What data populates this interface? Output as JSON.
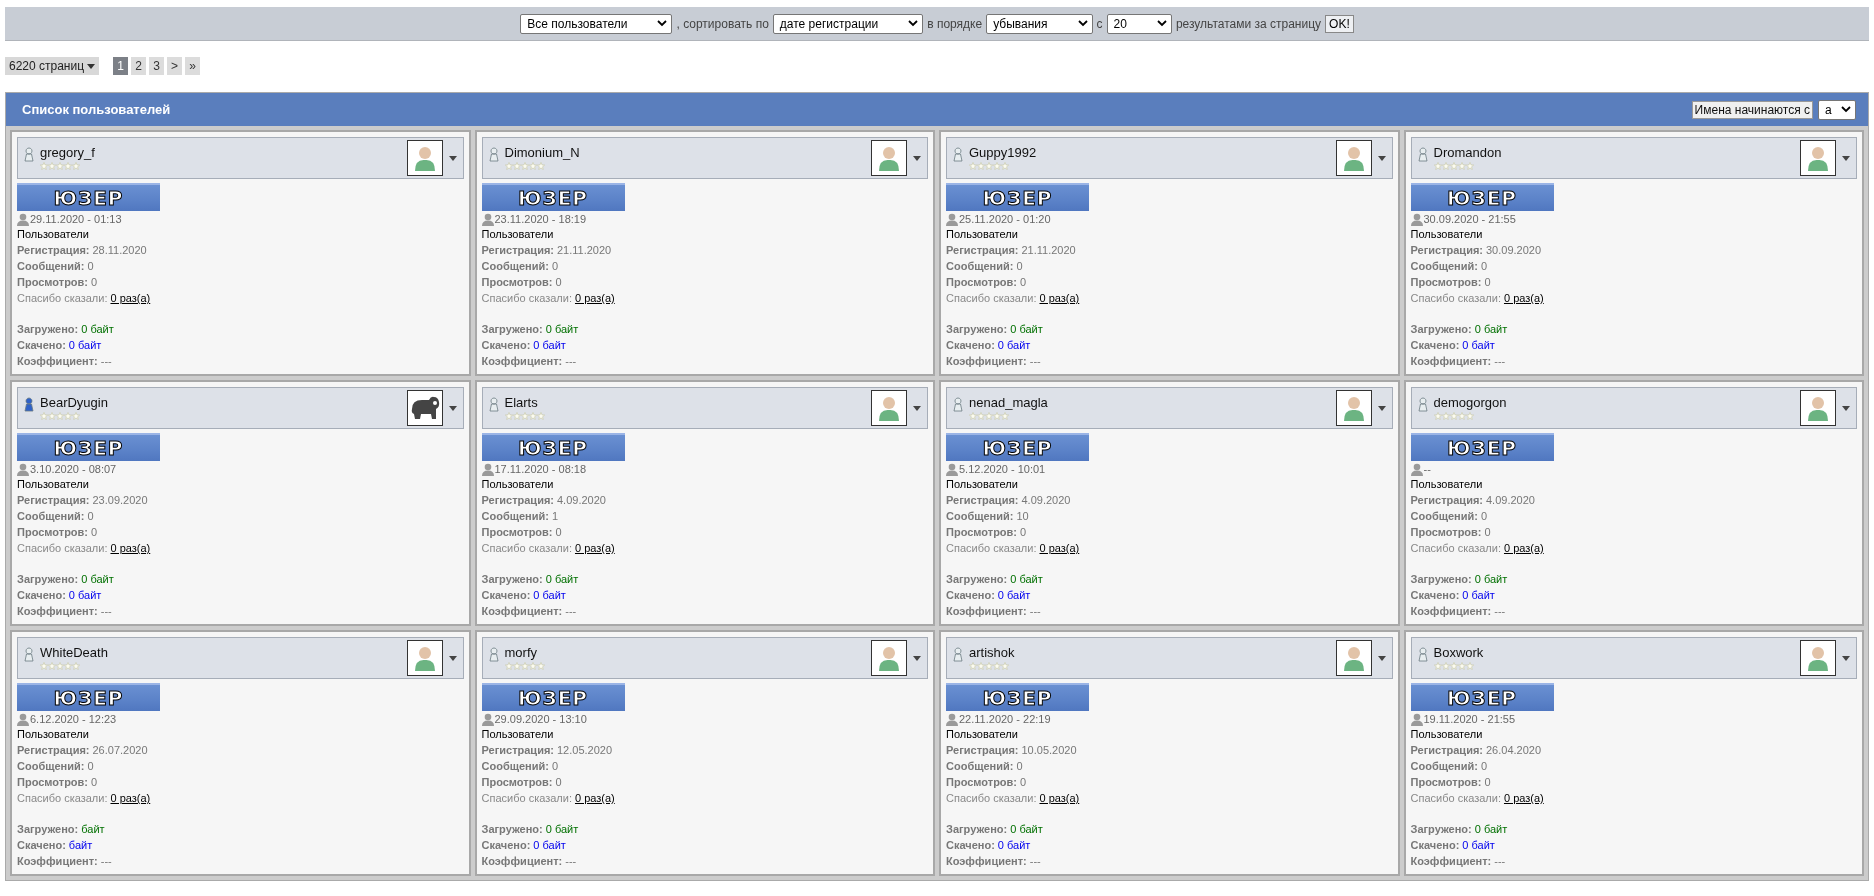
{
  "filter_bar": {
    "items": [
      {
        "kind": "select",
        "value": "Все пользователи"
      },
      {
        "kind": "text",
        "value": ", сортировать по"
      },
      {
        "kind": "select",
        "value": "дате регистрации"
      },
      {
        "kind": "text",
        "value": "в порядке"
      },
      {
        "kind": "select",
        "value": "убывания"
      },
      {
        "kind": "text",
        "value": "с"
      },
      {
        "kind": "select",
        "value": "20"
      },
      {
        "kind": "text",
        "value": "результатами за страницу"
      },
      {
        "kind": "button",
        "value": "OK!"
      }
    ]
  },
  "pagination": {
    "pages_dropdown": "6220 страниц",
    "pages": [
      {
        "label": "1",
        "selected": true
      },
      {
        "label": "2",
        "selected": false
      },
      {
        "label": "3",
        "selected": false
      },
      {
        "label": ">",
        "selected": false
      },
      {
        "label": "»",
        "selected": false
      }
    ]
  },
  "panel": {
    "title": "Список пользователей",
    "filter_label": "Имена начинаются с",
    "filter_value": "a"
  },
  "users": [
    {
      "name": "gregory_f",
      "online": false,
      "stars": 0,
      "avatar": {
        "kind": "default"
      },
      "rank": "ЮЗЕР",
      "last_visit": "29.11.2020 - 01:13",
      "group": "Пользователи",
      "stats": [
        {
          "kind": "plain",
          "label": "Регистрация:",
          "value": "28.11.2020"
        },
        {
          "kind": "plain",
          "label": "Сообщений:",
          "value": "0"
        },
        {
          "kind": "plain",
          "label": "Просмотров:",
          "value": "0"
        },
        {
          "kind": "thanks",
          "label": "Спасибо сказали:",
          "value": "0 раз(а)"
        },
        {
          "kind": "up",
          "label": "Загружено:",
          "value": "0 байт"
        },
        {
          "kind": "down",
          "label": "Скачено:",
          "value": "0 байт"
        },
        {
          "kind": "plain",
          "label": "Коэффициент:",
          "value": "---"
        }
      ]
    },
    {
      "name": "Dimonium_N",
      "online": false,
      "stars": 0,
      "avatar": {
        "kind": "default"
      },
      "rank": "ЮЗЕР",
      "last_visit": "23.11.2020 - 18:19",
      "group": "Пользователи",
      "stats": [
        {
          "kind": "plain",
          "label": "Регистрация:",
          "value": "21.11.2020"
        },
        {
          "kind": "plain",
          "label": "Сообщений:",
          "value": "0"
        },
        {
          "kind": "plain",
          "label": "Просмотров:",
          "value": "0"
        },
        {
          "kind": "thanks",
          "label": "Спасибо сказали:",
          "value": "0 раз(а)"
        },
        {
          "kind": "up",
          "label": "Загружено:",
          "value": "0 байт"
        },
        {
          "kind": "down",
          "label": "Скачено:",
          "value": "0 байт"
        },
        {
          "kind": "plain",
          "label": "Коэффициент:",
          "value": "---"
        }
      ]
    },
    {
      "name": "Guppy1992",
      "online": false,
      "stars": 0,
      "avatar": {
        "kind": "default"
      },
      "rank": "ЮЗЕР",
      "last_visit": "25.11.2020 - 01:20",
      "group": "Пользователи",
      "stats": [
        {
          "kind": "plain",
          "label": "Регистрация:",
          "value": "21.11.2020"
        },
        {
          "kind": "plain",
          "label": "Сообщений:",
          "value": "0"
        },
        {
          "kind": "plain",
          "label": "Просмотров:",
          "value": "0"
        },
        {
          "kind": "thanks",
          "label": "Спасибо сказали:",
          "value": "0 раз(а)"
        },
        {
          "kind": "up",
          "label": "Загружено:",
          "value": "0 байт"
        },
        {
          "kind": "down",
          "label": "Скачено:",
          "value": "0 байт"
        },
        {
          "kind": "plain",
          "label": "Коэффициент:",
          "value": "---"
        }
      ]
    },
    {
      "name": "Dromandon",
      "online": false,
      "stars": 0,
      "avatar": {
        "kind": "default"
      },
      "rank": "ЮЗЕР",
      "last_visit": "30.09.2020 - 21:55",
      "group": "Пользователи",
      "stats": [
        {
          "kind": "plain",
          "label": "Регистрация:",
          "value": "30.09.2020"
        },
        {
          "kind": "plain",
          "label": "Сообщений:",
          "value": "0"
        },
        {
          "kind": "plain",
          "label": "Просмотров:",
          "value": "0"
        },
        {
          "kind": "thanks",
          "label": "Спасибо сказали:",
          "value": "0 раз(а)"
        },
        {
          "kind": "up",
          "label": "Загружено:",
          "value": "0 байт"
        },
        {
          "kind": "down",
          "label": "Скачено:",
          "value": "0 байт"
        },
        {
          "kind": "plain",
          "label": "Коэффициент:",
          "value": "---"
        }
      ]
    },
    {
      "name": "BearDyugin",
      "online": true,
      "stars": 0,
      "avatar": {
        "kind": "bear"
      },
      "rank": "ЮЗЕР",
      "last_visit": "3.10.2020 - 08:07",
      "group": "Пользователи",
      "stats": [
        {
          "kind": "plain",
          "label": "Регистрация:",
          "value": "23.09.2020"
        },
        {
          "kind": "plain",
          "label": "Сообщений:",
          "value": "0"
        },
        {
          "kind": "plain",
          "label": "Просмотров:",
          "value": "0"
        },
        {
          "kind": "thanks",
          "label": "Спасибо сказали:",
          "value": "0 раз(а)"
        },
        {
          "kind": "up",
          "label": "Загружено:",
          "value": "0 байт"
        },
        {
          "kind": "down",
          "label": "Скачено:",
          "value": "0 байт"
        },
        {
          "kind": "plain",
          "label": "Коэффициент:",
          "value": "---"
        }
      ]
    },
    {
      "name": "Elarts",
      "online": false,
      "stars": 0,
      "avatar": {
        "kind": "default"
      },
      "rank": "ЮЗЕР",
      "last_visit": "17.11.2020 - 08:18",
      "group": "Пользователи",
      "stats": [
        {
          "kind": "plain",
          "label": "Регистрация:",
          "value": "4.09.2020"
        },
        {
          "kind": "plain",
          "label": "Сообщений:",
          "value": "1"
        },
        {
          "kind": "plain",
          "label": "Просмотров:",
          "value": "0"
        },
        {
          "kind": "thanks",
          "label": "Спасибо сказали:",
          "value": "0 раз(а)"
        },
        {
          "kind": "up",
          "label": "Загружено:",
          "value": "0 байт"
        },
        {
          "kind": "down",
          "label": "Скачено:",
          "value": "0 байт"
        },
        {
          "kind": "plain",
          "label": "Коэффициент:",
          "value": "---"
        }
      ]
    },
    {
      "name": "nenad_magla",
      "online": false,
      "stars": 0,
      "avatar": {
        "kind": "default"
      },
      "rank": "ЮЗЕР",
      "last_visit": "5.12.2020 - 10:01",
      "group": "Пользователи",
      "stats": [
        {
          "kind": "plain",
          "label": "Регистрация:",
          "value": "4.09.2020"
        },
        {
          "kind": "plain",
          "label": "Сообщений:",
          "value": "10"
        },
        {
          "kind": "plain",
          "label": "Просмотров:",
          "value": "0"
        },
        {
          "kind": "thanks",
          "label": "Спасибо сказали:",
          "value": "0 раз(а)"
        },
        {
          "kind": "up",
          "label": "Загружено:",
          "value": "0 байт"
        },
        {
          "kind": "down",
          "label": "Скачено:",
          "value": "0 байт"
        },
        {
          "kind": "plain",
          "label": "Коэффициент:",
          "value": "---"
        }
      ]
    },
    {
      "name": "demogorgon",
      "online": false,
      "stars": 0,
      "avatar": {
        "kind": "default"
      },
      "rank": "ЮЗЕР",
      "last_visit": "--",
      "group": "Пользователи",
      "stats": [
        {
          "kind": "plain",
          "label": "Регистрация:",
          "value": "4.09.2020"
        },
        {
          "kind": "plain",
          "label": "Сообщений:",
          "value": "0"
        },
        {
          "kind": "plain",
          "label": "Просмотров:",
          "value": "0"
        },
        {
          "kind": "thanks",
          "label": "Спасибо сказали:",
          "value": "0 раз(а)"
        },
        {
          "kind": "up",
          "label": "Загружено:",
          "value": "0 байт"
        },
        {
          "kind": "down",
          "label": "Скачено:",
          "value": "0 байт"
        },
        {
          "kind": "plain",
          "label": "Коэффициент:",
          "value": "---"
        }
      ]
    },
    {
      "name": "WhiteDeath",
      "online": false,
      "stars": 0,
      "avatar": {
        "kind": "default"
      },
      "rank": "ЮЗЕР",
      "last_visit": "6.12.2020 - 12:23",
      "group": "Пользователи",
      "stats": [
        {
          "kind": "plain",
          "label": "Регистрация:",
          "value": "26.07.2020"
        },
        {
          "kind": "plain",
          "label": "Сообщений:",
          "value": "0"
        },
        {
          "kind": "plain",
          "label": "Просмотров:",
          "value": "0"
        },
        {
          "kind": "thanks",
          "label": "Спасибо сказали:",
          "value": "0 раз(а)"
        },
        {
          "kind": "up",
          "label": "Загружено:",
          "value": "байт"
        },
        {
          "kind": "down",
          "label": "Скачено:",
          "value": "байт"
        },
        {
          "kind": "plain",
          "label": "Коэффициент:",
          "value": "---"
        }
      ]
    },
    {
      "name": "morfy",
      "online": false,
      "stars": 0,
      "avatar": {
        "kind": "default"
      },
      "rank": "ЮЗЕР",
      "last_visit": "29.09.2020 - 13:10",
      "group": "Пользователи",
      "stats": [
        {
          "kind": "plain",
          "label": "Регистрация:",
          "value": "12.05.2020"
        },
        {
          "kind": "plain",
          "label": "Сообщений:",
          "value": "0"
        },
        {
          "kind": "plain",
          "label": "Просмотров:",
          "value": "0"
        },
        {
          "kind": "thanks",
          "label": "Спасибо сказали:",
          "value": "0 раз(а)"
        },
        {
          "kind": "up",
          "label": "Загружено:",
          "value": "0 байт"
        },
        {
          "kind": "down",
          "label": "Скачено:",
          "value": "0 байт"
        },
        {
          "kind": "plain",
          "label": "Коэффициент:",
          "value": "---"
        }
      ]
    },
    {
      "name": "artishok",
      "online": false,
      "stars": 0,
      "avatar": {
        "kind": "default"
      },
      "rank": "ЮЗЕР",
      "last_visit": "22.11.2020 - 22:19",
      "group": "Пользователи",
      "stats": [
        {
          "kind": "plain",
          "label": "Регистрация:",
          "value": "10.05.2020"
        },
        {
          "kind": "plain",
          "label": "Сообщений:",
          "value": "0"
        },
        {
          "kind": "plain",
          "label": "Просмотров:",
          "value": "0"
        },
        {
          "kind": "thanks",
          "label": "Спасибо сказали:",
          "value": "0 раз(а)"
        },
        {
          "kind": "up",
          "label": "Загружено:",
          "value": "0 байт"
        },
        {
          "kind": "down",
          "label": "Скачено:",
          "value": "0 байт"
        },
        {
          "kind": "plain",
          "label": "Коэффициент:",
          "value": "---"
        }
      ]
    },
    {
      "name": "Boxwork",
      "online": false,
      "stars": 0,
      "avatar": {
        "kind": "default"
      },
      "rank": "ЮЗЕР",
      "last_visit": "19.11.2020 - 21:55",
      "group": "Пользователи",
      "stats": [
        {
          "kind": "plain",
          "label": "Регистрация:",
          "value": "26.04.2020"
        },
        {
          "kind": "plain",
          "label": "Сообщений:",
          "value": "0"
        },
        {
          "kind": "plain",
          "label": "Просмотров:",
          "value": "0"
        },
        {
          "kind": "thanks",
          "label": "Спасибо сказали:",
          "value": "0 раз(а)"
        },
        {
          "kind": "up",
          "label": "Загружено:",
          "value": "0 байт"
        },
        {
          "kind": "down",
          "label": "Скачено:",
          "value": "0 байт"
        },
        {
          "kind": "plain",
          "label": "Коэффициент:",
          "value": "---"
        }
      ]
    }
  ]
}
